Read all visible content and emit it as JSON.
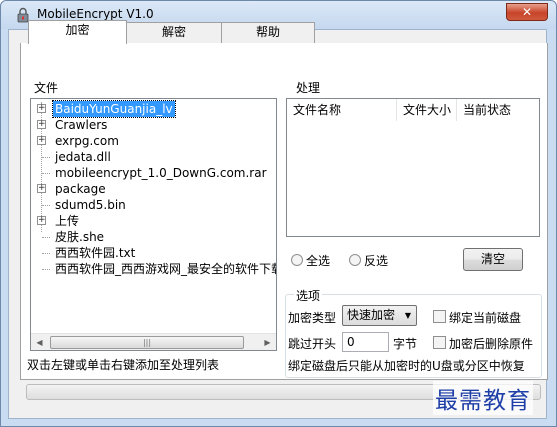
{
  "window": {
    "title": "MobileEncrypt V1.0",
    "close_glyph": "✕"
  },
  "tabs": [
    {
      "label": "加密",
      "active": true
    },
    {
      "label": "解密",
      "active": false
    },
    {
      "label": "帮助",
      "active": false
    }
  ],
  "files_panel": {
    "title": "文件",
    "tree": [
      {
        "label": "BaiduYunGuanjia_lv",
        "expandable": true,
        "selected": true
      },
      {
        "label": "Crawlers",
        "expandable": true
      },
      {
        "label": "exrpg.com",
        "expandable": true
      },
      {
        "label": "jedata.dll",
        "expandable": false
      },
      {
        "label": "mobileencrypt_1.0_DownG.com.rar",
        "expandable": false
      },
      {
        "label": "package",
        "expandable": true
      },
      {
        "label": "sdumd5.bin",
        "expandable": false
      },
      {
        "label": "上传",
        "expandable": true
      },
      {
        "label": "皮肤.she",
        "expandable": false
      },
      {
        "label": "西西软件园.txt",
        "expandable": false
      },
      {
        "label": "西西软件园_西西游戏网_最安全的软件下载",
        "expandable": false
      }
    ],
    "hint": "双击左键或单击右键添加至处理列表"
  },
  "process_panel": {
    "title": "处理",
    "columns": [
      "文件名称",
      "文件大小",
      "当前状态"
    ],
    "select_all": "全选",
    "invert_select": "反选",
    "clear_button": "清空"
  },
  "options": {
    "title": "选项",
    "encrypt_type_label": "加密类型",
    "encrypt_type_value": "快速加密",
    "bind_disk_label": "绑定当前磁盘",
    "skip_header_label": "跳过开头",
    "skip_header_value": "0",
    "skip_header_unit": "字节",
    "delete_after_label": "加密后删除原件",
    "note": "绑定磁盘后只能从加密时的U盘或分区中恢复"
  },
  "progress": {
    "value": 0
  },
  "watermark": "最需教育",
  "colors": {
    "selection": "#3399ff",
    "watermark": "#1f3fa8",
    "frame": "#c9dcf1"
  }
}
